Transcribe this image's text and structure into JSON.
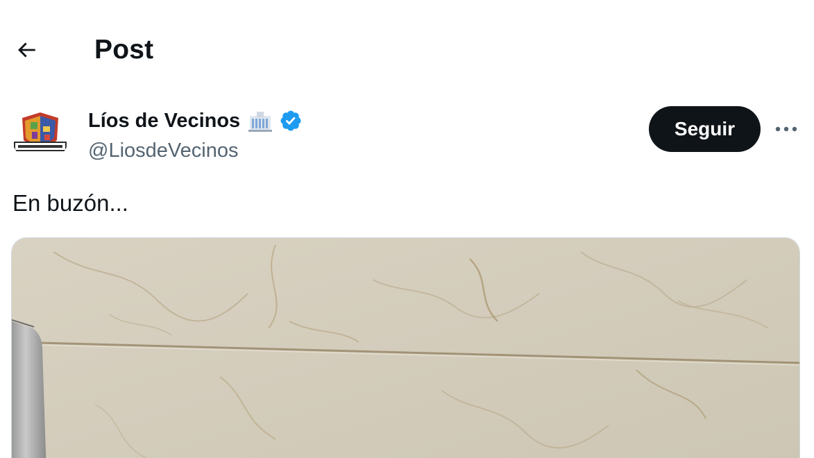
{
  "header": {
    "title": "Post",
    "back_icon": "arrow-left-icon"
  },
  "author": {
    "display_name": "Líos de Vecinos",
    "name_emoji_icon": "building-icon",
    "verified_icon": "verified-badge-icon",
    "handle": "@LiosdeVecinos",
    "avatar_label": "Líos de Vecinos"
  },
  "actions": {
    "follow_label": "Seguir",
    "more_icon": "more-horizontal-icon"
  },
  "post": {
    "text": "En buzón..."
  },
  "colors": {
    "text_primary": "#0f1419",
    "text_secondary": "#536471",
    "verified_blue": "#1d9bf0",
    "follow_bg": "#0f1419",
    "media_marble": "#d6cfbf"
  }
}
